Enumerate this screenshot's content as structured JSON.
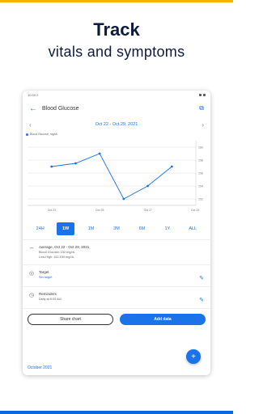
{
  "promo": {
    "title": "Track",
    "subtitle": "vitals and symptoms"
  },
  "status": {
    "time": "10:00",
    "extra": "2"
  },
  "appbar": {
    "title": "Blood Glucose"
  },
  "range": {
    "label": "Oct 22 - Oct 29, 2021"
  },
  "chart_data": {
    "type": "line",
    "legend": [
      "Blood Glucose, mg/dL"
    ],
    "x": [
      "Oct 22",
      "Oct 23",
      "Oct 24",
      "Oct 25",
      "Oct 26",
      "Oct 27",
      "Oct 28",
      "Oct 29"
    ],
    "x_tick_labels": [
      "Oct 23",
      "Oct 25",
      "Oct 27",
      "Oct 29"
    ],
    "y_tick_labels": [
      "152",
      "154",
      "156",
      "158",
      "160"
    ],
    "ylim": [
      151,
      161
    ],
    "series": [
      {
        "name": "Blood Glucose, mg/dL",
        "values": [
          null,
          157,
          157.5,
          159,
          152,
          154,
          157,
          null
        ]
      }
    ],
    "grid": true
  },
  "ranges": [
    "24H",
    "1W",
    "1M",
    "3M",
    "6M",
    "1Y",
    "ALL"
  ],
  "activeRange": "1W",
  "average": {
    "title": "Average, Oct 22 - Oct 29, 2021",
    "line1": "Blood Glucose: 152 mg/dL",
    "line2": "Low-High: 152-159 mg/dL"
  },
  "target": {
    "title": "Target",
    "link": "Set target"
  },
  "reminders": {
    "title": "Reminders",
    "value": "Daily at 8:00 AM"
  },
  "buttons": {
    "share": "Share chart",
    "add": "Add data"
  },
  "month": "October 2021",
  "colors": {
    "accent": "#1a73e8",
    "topbar": "#f2b705",
    "bottombar": "#0a6ad9"
  }
}
